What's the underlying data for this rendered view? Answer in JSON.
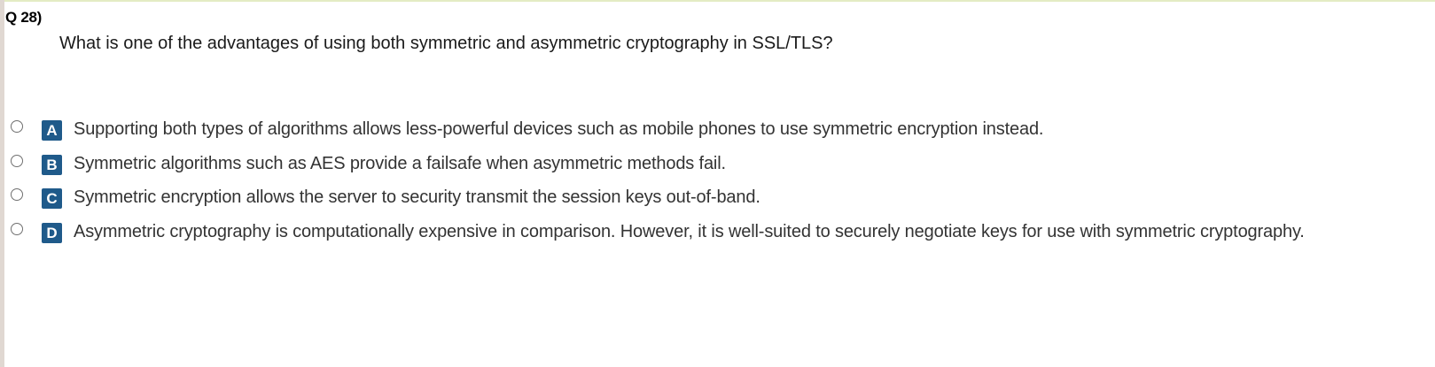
{
  "question": {
    "number_label": "Q 28)",
    "text": "What is one of the advantages of using both symmetric and asymmetric cryptography in SSL/TLS?"
  },
  "answers": [
    {
      "letter": "A",
      "text": "Supporting both types of algorithms allows less-powerful devices such as mobile phones to use symmetric encryption instead."
    },
    {
      "letter": "B",
      "text": "Symmetric algorithms such as AES provide a failsafe when asymmetric methods fail."
    },
    {
      "letter": "C",
      "text": "Symmetric encryption allows the server to security transmit the session keys out-of-band."
    },
    {
      "letter": "D",
      "text": "Asymmetric cryptography is computationally expensive in comparison. However, it is well-suited to securely negotiate keys for use with symmetric cryptography."
    }
  ],
  "colors": {
    "badge": "#1f5a8a",
    "text": "#333333",
    "left_bar": "#e0d8d2",
    "top_rule": "#e4ecc4"
  }
}
